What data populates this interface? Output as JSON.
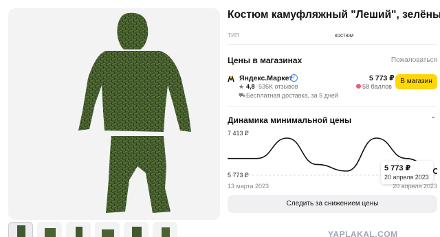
{
  "product": {
    "title": "Костюм камуфляжный \"Леший\", зелёный",
    "spec_key": "ТИП",
    "spec_value": "костюм"
  },
  "prices": {
    "heading": "Цены в магазинах",
    "complain": "Пожаловаться",
    "offer": {
      "shop_name": "Яндекс.Маркет",
      "rating": "4,8",
      "reviews": "536K отзывов",
      "delivery": "Бесплатная доставка, за 5 дней",
      "price": "5 773 ₽",
      "bonus": "58 баллов",
      "button": "В магазин"
    }
  },
  "dynamics": {
    "heading": "Динамика минимальной цены",
    "toggle": "⌃",
    "tooltip_price": "5 773 ₽",
    "tooltip_date": "20 апреля 2023",
    "y_top_label": "7 413 ₽",
    "y_bottom_label": "5 773 ₽",
    "x_start_label": "13 марта 2023",
    "x_end_label": "20 апреля 2023"
  },
  "chart_data": {
    "type": "line",
    "x": [
      "13 марта 2023",
      "20 апреля 2023"
    ],
    "series": [
      {
        "values": [
          6400,
          6400,
          7413,
          6100,
          5773,
          7413,
          6400,
          5773
        ]
      }
    ],
    "ylim": [
      5773,
      7413
    ],
    "yticks": [
      "7 413 ₽",
      "5 773 ₽"
    ],
    "xlabel": "",
    "ylabel": ""
  },
  "follow_button": "Следить за снижением цены",
  "watermark": "YAPLAKAL.COM",
  "colors": {
    "accent_button": "#ffd60a",
    "verified": "#3b82f6"
  },
  "icons": {
    "shop": "yandex-market-icon",
    "star": "star-icon",
    "truck": "truck-icon",
    "verified": "verified-check-icon"
  }
}
